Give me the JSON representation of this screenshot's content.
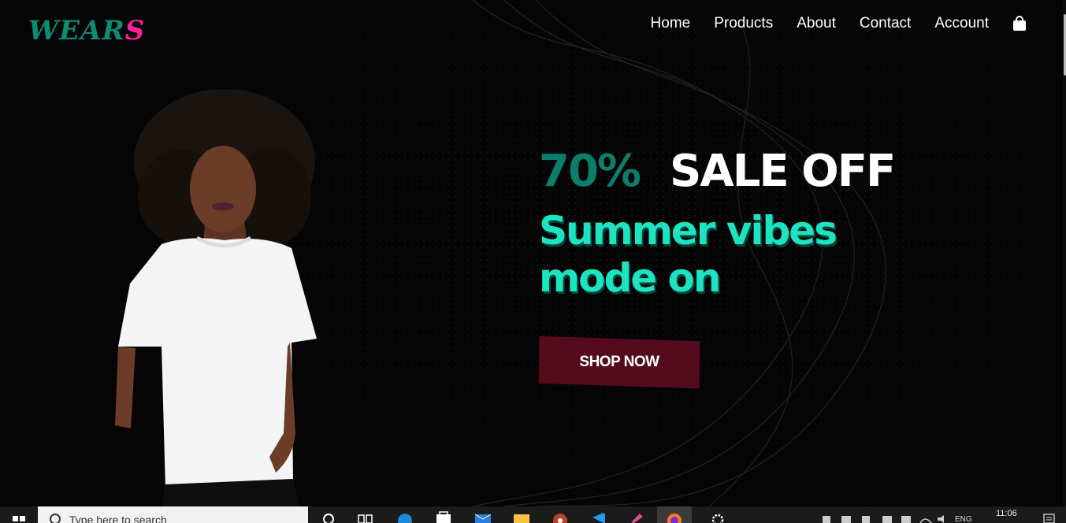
{
  "brand": {
    "logo_main": "WEAR",
    "logo_accent": "S"
  },
  "nav": {
    "items": [
      "Home",
      "Products",
      "About",
      "Contact",
      "Account"
    ],
    "cart_icon": "shopping-bag-icon"
  },
  "hero": {
    "percent": "70%",
    "sale_text": "SALE OFF",
    "headline_line1": "Summer vibes",
    "headline_line2": "mode on",
    "cta": "SHOP NOW"
  },
  "taskbar": {
    "search_placeholder": "Type here to search",
    "language": "ENG",
    "time": "11:06"
  },
  "colors": {
    "background": "#050505",
    "brand_green": "#0d8b73",
    "brand_pink": "#ff1e9b",
    "headline": "#1ee3c0",
    "cta_bg": "#540b1e"
  }
}
